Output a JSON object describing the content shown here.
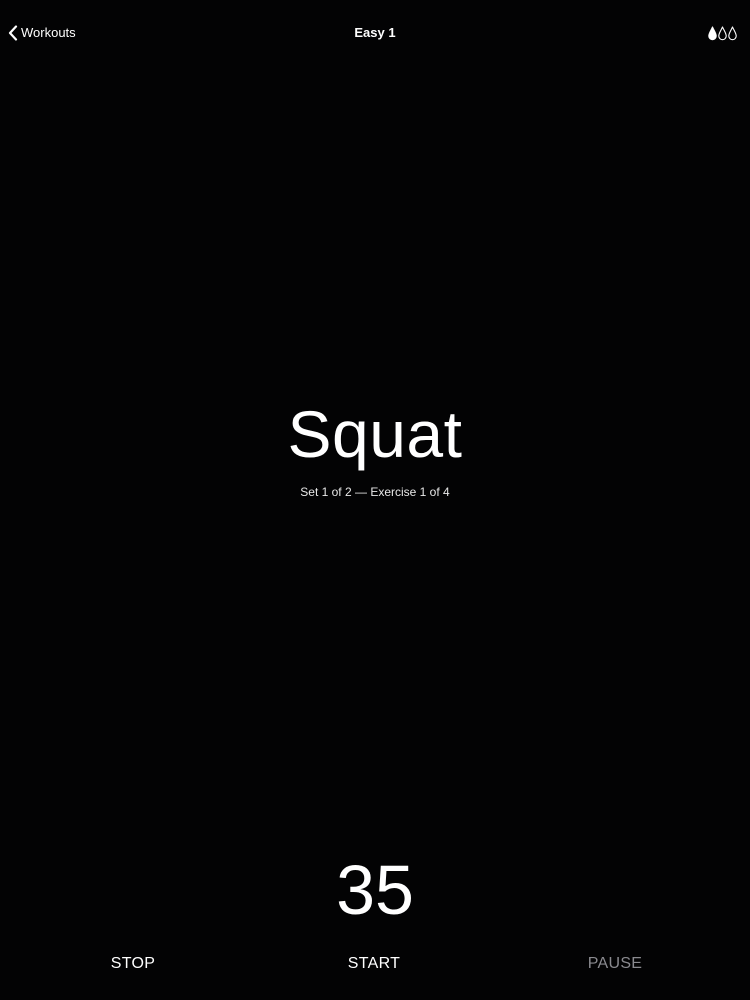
{
  "navbar": {
    "back_label": "Workouts",
    "title": "Easy 1",
    "difficulty": {
      "level": 1,
      "max": 3,
      "icon": "drop-icon"
    }
  },
  "exercise": {
    "name": "Squat",
    "progress": "Set 1 of 2 — Exercise 1 of 4"
  },
  "timer": {
    "value": "35"
  },
  "controls": {
    "stop_label": "STOP",
    "start_label": "START",
    "pause_label": "PAUSE"
  },
  "colors": {
    "background": "#030304",
    "text": "#ffffff",
    "disabled": "#8a8a8f"
  }
}
